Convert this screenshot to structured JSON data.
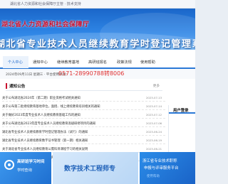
{
  "topbar": {
    "text": "湖北省人力资源和社会保障厅主管 · 技术支持"
  },
  "banner": {
    "org_name": "湖北省人力资源和社会保障厅",
    "system_title": "湖北省专业技术人员继续教育学时登记管理系统"
  },
  "nav": {
    "items": [
      {
        "label": "个人中心",
        "active": true
      },
      {
        "label": "通知中心",
        "active": false
      },
      {
        "label": "继续教育基地",
        "active": false
      },
      {
        "label": "高研班报名",
        "active": false
      },
      {
        "label": "政策法规",
        "active": false
      },
      {
        "label": "使用帮助",
        "active": false
      }
    ]
  },
  "notice": {
    "date": "2024年09月11日 星期三 · 平台使用热线：",
    "hotline": "0571-28990788转8006"
  },
  "news": {
    "title": "通知公告",
    "more": "更多",
    "items": [
      {
        "text": "关于公布湖北省2024年（第二期）职业资格考试相关通知",
        "date": "2023-07-13"
      },
      {
        "text": "关于公布第二批继续教育基地单位，面授、线上继续教育培训相关的通知",
        "date": "2023-07-14"
      },
      {
        "text": "关于做好2023年度专业技术人员继续教育基础工作的通知",
        "date": "2023-07-12"
      },
      {
        "text": "关于公布湖北省2023年度专业技术人员继续教育高级研修项目的通知",
        "date": "2023-07-06"
      },
      {
        "text": "湖北省专业技术人员继续教育学时登记管理办法（试行）的通知",
        "date": "2023-06-24"
      },
      {
        "text": "湖北省专业技术人员继续教育数字证书管理（第一期）相关通知",
        "date": "2023-06-19"
      },
      {
        "text": "关于湖北省专业技术人员继续教育公需科目课程学习的相关说明",
        "date": "2023-06-21"
      },
      {
        "text": "关于开展湖北省专业技术人员继续教育学时登记工作的通知",
        "date": "2023-06-08"
      }
    ]
  },
  "login": {
    "title": "用户登录"
  },
  "footer": {
    "card1_line1": "高研班学习时间",
    "card1_line2": "学时查询",
    "card2_text": "数字技术工程师专",
    "card3_line1": "浙江省专业技术职称",
    "card3_line2": "申报与评审服务平台",
    "card3_line3": "使用帮助"
  }
}
